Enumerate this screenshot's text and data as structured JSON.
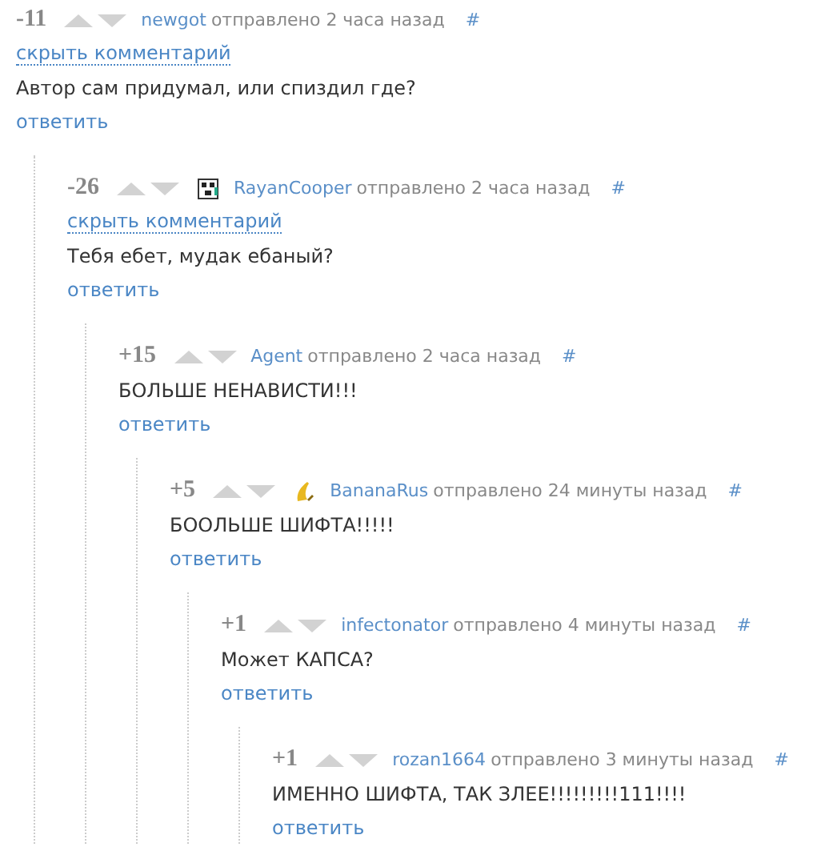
{
  "comments": [
    {
      "rating": "-11",
      "author": "newgot",
      "has_avatar": false,
      "posted": "отправлено 2 часа назад",
      "anchor": "#",
      "hide_label": "скрыть комментарий",
      "text": "Автор сам придумал, или спиздил где?",
      "reply_label": "ответить",
      "children": [
        {
          "rating": "-26",
          "author": "RayanCooper",
          "has_avatar": true,
          "posted": "отправлено 2 часа назад",
          "anchor": "#",
          "hide_label": "скрыть комментарий",
          "text": "Тебя ебет, мудак ебаный?",
          "reply_label": "ответить",
          "children": [
            {
              "rating": "+15",
              "author": "Agent",
              "has_avatar": false,
              "posted": "отправлено 2 часа назад",
              "anchor": "#",
              "text": "БОЛЬШЕ НЕНАВИСТИ!!!",
              "reply_label": "ответить",
              "children": [
                {
                  "rating": "+5",
                  "author": "BananaRus",
                  "has_avatar": true,
                  "posted": "отправлено 24 минуты назад",
                  "anchor": "#",
                  "text": "БООЛЬШЕ ШИФТА!!!!!",
                  "reply_label": "ответить",
                  "children": [
                    {
                      "rating": "+1",
                      "author": "infectonator",
                      "has_avatar": false,
                      "posted": "отправлено 4 минуты назад",
                      "anchor": "#",
                      "text": "Может КАПСА?",
                      "reply_label": "ответить",
                      "children": [
                        {
                          "rating": "+1",
                          "author": "rozan1664",
                          "has_avatar": false,
                          "posted": "отправлено 3 минуты назад",
                          "anchor": "#",
                          "text": "ИМЕННО ШИФТА, ТАК ЗЛЕЕ!!!!!!!!!111!!!!",
                          "reply_label": "ответить"
                        }
                      ]
                    }
                  ]
                }
              ]
            }
          ]
        }
      ]
    }
  ]
}
